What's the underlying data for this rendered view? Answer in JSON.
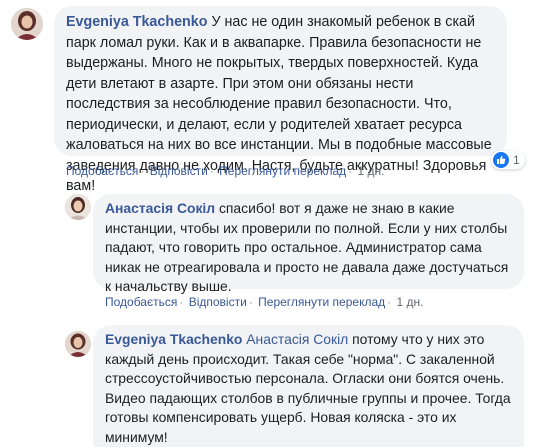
{
  "comments": [
    {
      "author": "Evgeniya Tkachenko",
      "mention": "",
      "text": "У нас не один знакомый ребенок в скай парк ломал руки. Как и в аквапарке. Правила безопасности не выдержаны. Много не покрытых, твердых поверхностей. Куда дети влетают в азарте. При этом они обязаны нести последствия за несоблюдение правил безопасности. Что, периодически, и делают, если у родителей хватает ресурса жаловаться на них во все инстанции. Мы в подобные массовые заведения давно не ходим. Настя, будьте аккуратны! Здоровья вам!",
      "actions": {
        "like": "Подобається",
        "reply": "Відповісти",
        "translate": "Переглянути переклад",
        "time": "1 дн."
      },
      "reaction_count": "1"
    },
    {
      "author": "Анастасія Сокіл",
      "mention": "",
      "text": "спасибо! вот я даже не знаю в какие инстанции, чтобы их проверили по полной. Если у них столбы падают, что говорить про остальное. Администратор сама никак не отреагировала и просто не давала даже достучаться к начальству выше.",
      "actions": {
        "like": "Подобається",
        "reply": "Відповісти",
        "translate": "Переглянути переклад",
        "time": "1 дн."
      }
    },
    {
      "author": "Evgeniya Tkachenko",
      "mention": "Анастасія Сокіл",
      "text": "потому что у них это каждый день происходит. Такая себе \"норма\". С закаленной стрессоустойчивостью персонала. Огласки они боятся очень. Видео падающих столбов в публичные группы и прочее. Тогда готовы компенсировать ущерб. Новая коляска - это их минимум!"
    }
  ],
  "colors": {
    "link": "#385898",
    "bubble": "#f2f3f5",
    "like_blue": "#1877f2"
  }
}
